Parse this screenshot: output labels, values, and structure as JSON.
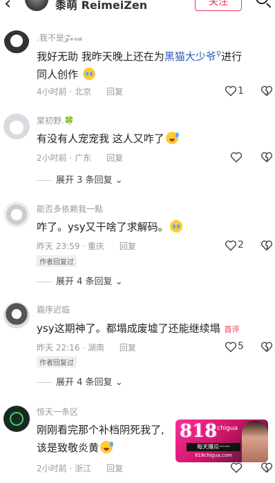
{
  "topbar": {
    "back_icon": "chevron-left",
    "user_name": "黍萌 ReimeiZen",
    "follow_label": "关注",
    "search_icon": "search-icon"
  },
  "comments": [
    {
      "username": ".我不是𝓩𝓸𝓻𝓪",
      "text_before_link": "我好无助 我昨天晚上还在为",
      "link": "黑猫大少爷",
      "text_after_link": "进行同人创作",
      "emoji": "crying-face",
      "time_location": "4小时前 · 北京",
      "reply_label": "回复",
      "likes": "1"
    },
    {
      "username": "棠初野.🍀",
      "text": "有没有人宠宠我 这人又咋了",
      "emoji": "sweat-smile-face",
      "time_location": "2小时前 · 广东",
      "reply_label": "回复",
      "likes": "",
      "expand_label": "展开 3 条回复"
    },
    {
      "username": "能否多依赖我一點",
      "text": "咋了。ysy又干啥了求解码。",
      "emoji": "crying-face",
      "time_location": "昨天 23:59 · 重庆",
      "reply_label": "回复",
      "author_tag": "作者回复过",
      "likes": "2",
      "expand_label": "展开 4 条回复"
    },
    {
      "username": "霜序迟临",
      "text": "ysy这期神了。都塌成废墟了还能继续塌",
      "hot_tag": "首评",
      "time_location": "昨天 22:16 · 湖南",
      "reply_label": "回复",
      "author_tag": "作者回复过",
      "likes": "5",
      "expand_label": "展开 4 条回复"
    },
    {
      "username": "惊天一条区",
      "text_line1": "刚刚看完那个补档阴死我了,",
      "text_line2": "该是致敬炎黄",
      "emoji": "sweat-smile-face",
      "time_location": "2小时前 · 浙江",
      "reply_label": "回复",
      "likes": ""
    }
  ],
  "ad_overlay": {
    "big_text": "818",
    "brand": "chigua",
    "line1": "每天爆瓜一一",
    "line2": "818chigua.com"
  },
  "colors": {
    "link": "#2b5bb8",
    "accent": "#ee3355",
    "meta": "#999999"
  }
}
